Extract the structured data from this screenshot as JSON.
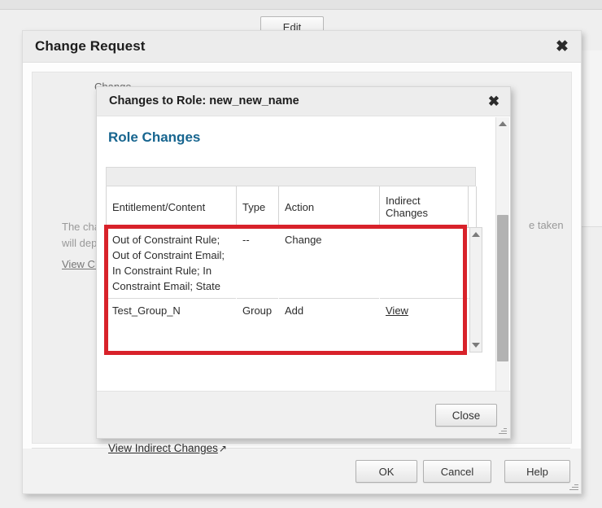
{
  "page": {
    "edit_button": "Edit"
  },
  "outer_dialog": {
    "title": "Change Request",
    "close_icon": "close-icon",
    "field_label": "Change",
    "paragraph": "The change\nwill depend",
    "paragraph_right_fragment": "e taken",
    "view_changes_link": "View Chan",
    "buttons": {
      "ok": "OK",
      "cancel": "Cancel",
      "help": "Help"
    }
  },
  "inner_dialog": {
    "title": "Changes to Role: new_new_name",
    "close_icon": "close-icon",
    "section_heading": "Role Changes",
    "table": {
      "columns": [
        "Entitlement/Content",
        "Type",
        "Action",
        "Indirect Changes"
      ],
      "rows": [
        {
          "entitlement": "Out of Constraint Rule; Out of Constraint Email; In Constraint Rule; In Constraint Email; State",
          "type": "--",
          "action": "Change",
          "indirect": ""
        },
        {
          "entitlement": "Test_Group_N",
          "type": "Group",
          "action": "Add",
          "indirect": "View"
        }
      ]
    },
    "view_indirect_changes": "View Indirect Changes",
    "external_link_icon": "↗",
    "close_button": "Close",
    "scroll_up_icon": "triangle-up-icon",
    "scroll_down_icon": "triangle-down-icon"
  },
  "colors": {
    "highlight": "#d8222a",
    "heading": "#17658f",
    "scroll_thumb": "#b2b2b2"
  }
}
